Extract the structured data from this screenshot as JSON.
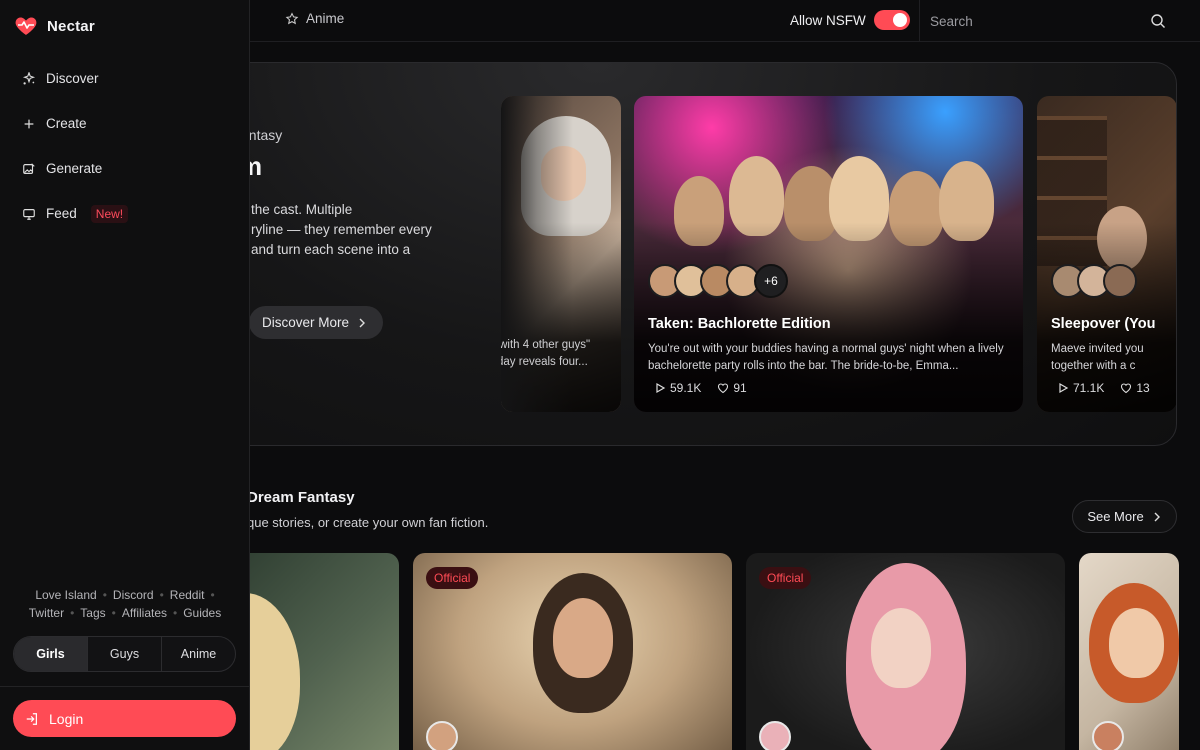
{
  "brand": {
    "name": "Nectar"
  },
  "sidebar": {
    "nav": [
      {
        "label": "Discover",
        "icon": "sparkle-icon"
      },
      {
        "label": "Create",
        "icon": "plus-icon"
      },
      {
        "label": "Generate",
        "icon": "image-edit-icon"
      },
      {
        "label": "Feed",
        "icon": "monitor-icon",
        "badge": "New!"
      }
    ],
    "footer_links_row1": [
      "Love Island",
      "Discord",
      "Reddit"
    ],
    "footer_links_row2": [
      "Twitter",
      "Tags",
      "Affiliates",
      "Guides"
    ],
    "segments": [
      "Girls",
      "Guys",
      "Anime"
    ],
    "active_segment": "Girls",
    "login_label": "Login"
  },
  "topbar": {
    "anime_tab": "Anime",
    "nsfw_label": "Allow NSFW",
    "nsfw_enabled": true,
    "search_placeholder": "Search"
  },
  "hero": {
    "kicker": "antasy",
    "title": "m",
    "desc_line1": "the cast. Multiple",
    "desc_line2": "ryline — they remember every",
    "desc_line3": "and turn each scene into a",
    "discover_label": "Discover More",
    "cards": [
      {
        "desc_line1": "\"with 4 other guys\"",
        "desc_line2": "day reveals four..."
      },
      {
        "title": "Taken: Bachlorette Edition",
        "desc": "You're out with your buddies having a normal guys' night when a lively bachelorette party rolls into the bar. The bride-to-be, Emma...",
        "more_avatars": "+6",
        "plays": "59.1K",
        "likes": "91"
      },
      {
        "title": "Sleepover (You",
        "desc_line1": "Maeve invited you",
        "desc_line2": "together with a c",
        "plays": "71.1K",
        "likes": "13"
      }
    ]
  },
  "section": {
    "title": "Dream Fantasy",
    "subtitle": "que stories, or create your own fan fiction.",
    "see_more_label": "See More",
    "cards": [
      {
        "tag": ""
      },
      {
        "tag": "Official"
      },
      {
        "tag": "Official"
      },
      {
        "tag": ""
      }
    ]
  },
  "colors": {
    "accent": "#ff4b55",
    "bg": "#0c0c0d"
  }
}
